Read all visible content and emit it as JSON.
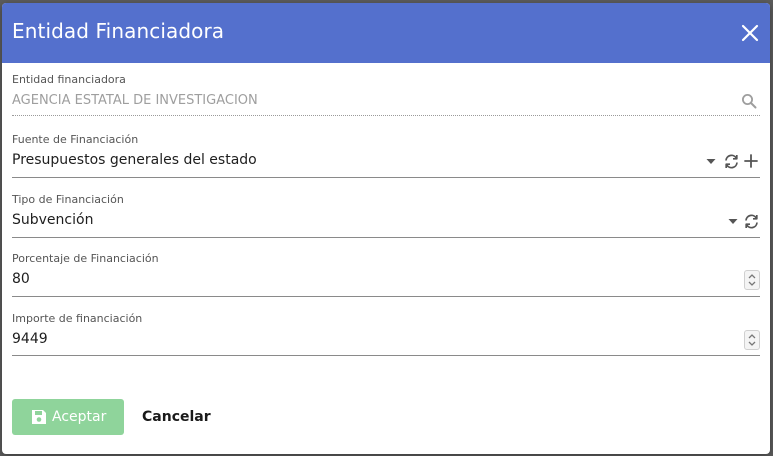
{
  "dialog": {
    "title": "Entidad Financiadora",
    "header_color": "#5470cd"
  },
  "fields": {
    "entidad": {
      "label": "Entidad financiadora",
      "value": "AGENCIA ESTATAL DE INVESTIGACION",
      "icon": "search-icon"
    },
    "fuente": {
      "label": "Fuente de Financiación",
      "value": "Presupuestos generales del estado",
      "icons": [
        "dropdown-arrow-icon",
        "refresh-icon",
        "add-icon"
      ]
    },
    "tipo": {
      "label": "Tipo de Financiación",
      "value": "Subvención",
      "icons": [
        "dropdown-arrow-icon",
        "refresh-icon"
      ]
    },
    "porcentaje": {
      "label": "Porcentaje de Financiación",
      "value": "80"
    },
    "importe": {
      "label": "Importe de financiación",
      "value": "9449"
    }
  },
  "actions": {
    "save_label": "Aceptar",
    "save_color": "#8fd49b",
    "save_icon": "floppy-disk-icon",
    "cancel_label": "Cancelar"
  }
}
